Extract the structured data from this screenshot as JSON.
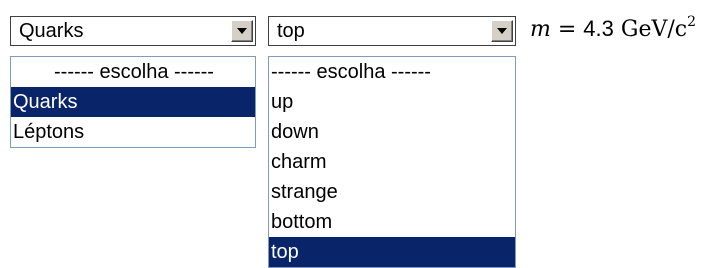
{
  "category_select": {
    "value": "Quarks",
    "options": [
      "------ escolha ------",
      "Quarks",
      "Léptons"
    ],
    "selected_index": 1
  },
  "particle_select": {
    "value": "top",
    "options": [
      "------ escolha ------",
      "up",
      "down",
      "charm",
      "strange",
      "bottom",
      "top"
    ],
    "selected_index": 6
  },
  "mass_readout": {
    "symbol": "m",
    "equals": " = ",
    "value": "4.3",
    "unit": " GeV/c",
    "unit_exponent": "2"
  },
  "colors": {
    "selection_bg": "#0a246a",
    "selection_fg": "#ffffff",
    "list_border": "#7f9db9"
  }
}
